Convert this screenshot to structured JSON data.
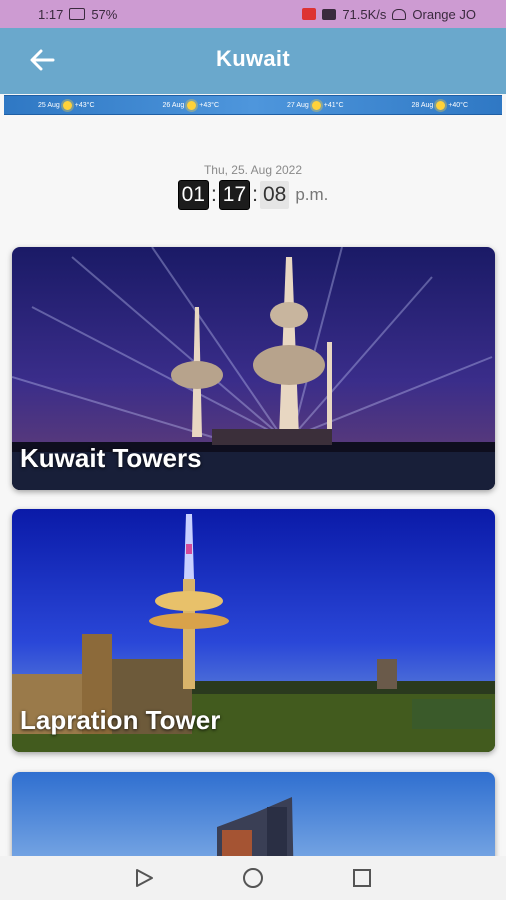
{
  "status_bar": {
    "time": "1:17",
    "battery": "57%",
    "speed": "71.5K/s",
    "carrier": "Orange JO"
  },
  "app_bar": {
    "title": "Kuwait",
    "back_icon": "arrow-left-icon"
  },
  "forecast": [
    {
      "date": "25 Aug",
      "temp": "+43°C",
      "icon": "sun-icon"
    },
    {
      "date": "26 Aug",
      "temp": "+43°C",
      "icon": "sun-icon"
    },
    {
      "date": "27 Aug",
      "temp": "+41°C",
      "icon": "sun-icon"
    },
    {
      "date": "28 Aug",
      "temp": "+40°C",
      "icon": "sun-icon"
    }
  ],
  "clock": {
    "date": "Thu, 25. Aug 2022",
    "hours": "01",
    "minutes": "17",
    "seconds": "08",
    "ampm": "p.m."
  },
  "places": [
    {
      "label": "Kuwait Towers"
    },
    {
      "label": "Lapration Tower"
    }
  ],
  "colors": {
    "status_bar": "#cd9bd2",
    "app_bar": "#6aa8cc",
    "background": "#f7f7f7"
  },
  "nav": {
    "back": "triangle-back-icon",
    "home": "circle-home-icon",
    "recents": "square-recents-icon"
  }
}
